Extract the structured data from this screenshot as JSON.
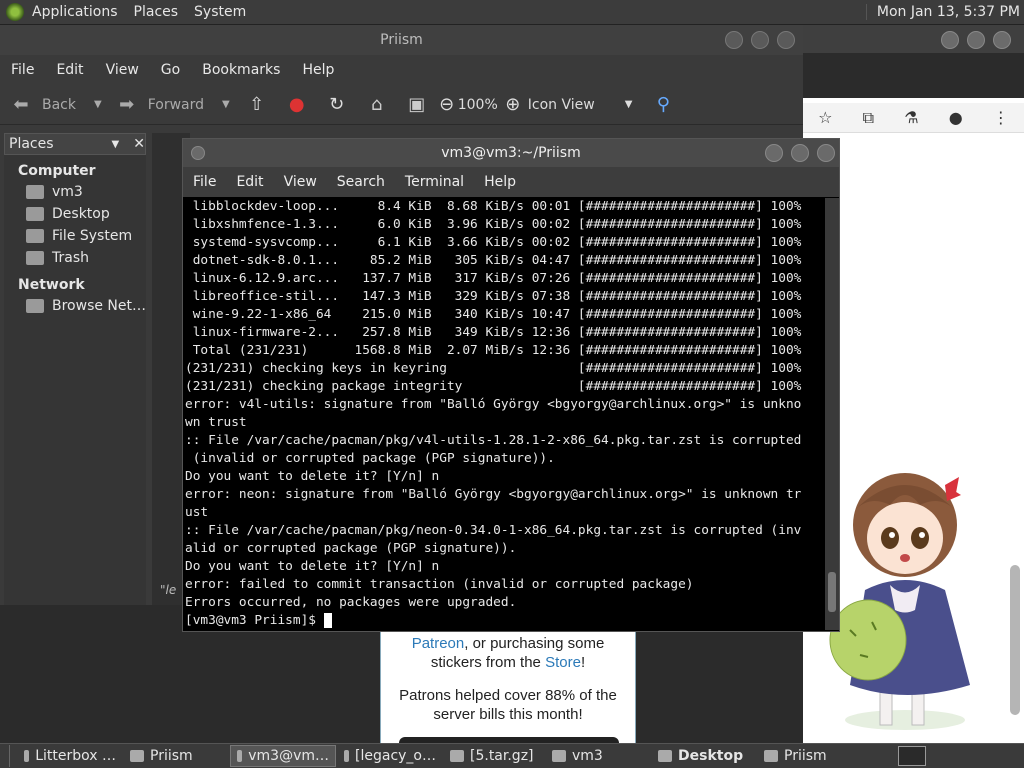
{
  "top_panel": {
    "menus": [
      "Applications",
      "Places",
      "System"
    ],
    "clock": "Mon Jan 13,  5:37 PM"
  },
  "file_manager": {
    "title": "Priism",
    "menu": [
      "File",
      "Edit",
      "View",
      "Go",
      "Bookmarks",
      "Help"
    ],
    "toolbar": {
      "back": "Back",
      "forward": "Forward",
      "zoom": "100%",
      "view_mode": "Icon View"
    },
    "sidebar": {
      "header": "Places",
      "sections": [
        {
          "title": "Computer",
          "items": [
            "vm3",
            "Desktop",
            "File System",
            "Trash"
          ]
        },
        {
          "title": "Network",
          "items": [
            "Browse Net…"
          ]
        }
      ]
    },
    "status_fragment": "\"le"
  },
  "terminal": {
    "title": "vm3@vm3:~/Priism",
    "menu": [
      "File",
      "Edit",
      "View",
      "Search",
      "Terminal",
      "Help"
    ],
    "lines": [
      " libblockdev-loop...     8.4 KiB  8.68 KiB/s 00:01 [######################] 100%",
      " libxshmfence-1.3...     6.0 KiB  3.96 KiB/s 00:02 [######################] 100%",
      " systemd-sysvcomp...     6.1 KiB  3.66 KiB/s 00:02 [######################] 100%",
      " dotnet-sdk-8.0.1...    85.2 MiB   305 KiB/s 04:47 [######################] 100%",
      " linux-6.12.9.arc...   137.7 MiB   317 KiB/s 07:26 [######################] 100%",
      " libreoffice-stil...   147.3 MiB   329 KiB/s 07:38 [######################] 100%",
      " wine-9.22-1-x86_64    215.0 MiB   340 KiB/s 10:47 [######################] 100%",
      " linux-firmware-2...   257.8 MiB   349 KiB/s 12:36 [######################] 100%",
      " Total (231/231)      1568.8 MiB  2.07 MiB/s 12:36 [######################] 100%",
      "(231/231) checking keys in keyring                 [######################] 100%",
      "(231/231) checking package integrity               [######################] 100%",
      "error: v4l-utils: signature from \"Balló György <bgyorgy@archlinux.org>\" is unkno",
      "wn trust",
      ":: File /var/cache/pacman/pkg/v4l-utils-1.28.1-2-x86_64.pkg.tar.zst is corrupted",
      " (invalid or corrupted package (PGP signature)).",
      "Do you want to delete it? [Y/n] n",
      "error: neon: signature from \"Balló György <bgyorgy@archlinux.org>\" is unknown tr",
      "ust",
      ":: File /var/cache/pacman/pkg/neon-0.34.0-1-x86_64.pkg.tar.zst is corrupted (inv",
      "alid or corrupted package (PGP signature)).",
      "Do you want to delete it? [Y/n] n",
      "error: failed to commit transaction (invalid or corrupted package)",
      "Errors occurred, no packages were upgraded."
    ],
    "prompt": "[vm3@vm3 Priism]$ "
  },
  "web_page": {
    "line1_link": "Patreon",
    "line1_rest": ", or purchasing some",
    "line2_pre": "stickers from the ",
    "line2_link": "Store",
    "line2_post": "!",
    "patrons": "Patrons helped cover 88% of the server bills this month!"
  },
  "taskbar": {
    "tasks": [
      {
        "label": "Litterbox …",
        "active": false,
        "bold": false
      },
      {
        "label": "Priism",
        "active": false,
        "bold": false
      },
      {
        "label": "vm3@vm…",
        "active": true,
        "bold": false
      },
      {
        "label": "[legacy_o…",
        "active": false,
        "bold": false
      },
      {
        "label": "[5.tar.gz]",
        "active": false,
        "bold": false
      },
      {
        "label": "vm3",
        "active": false,
        "bold": false
      },
      {
        "label": "Desktop",
        "active": false,
        "bold": true
      },
      {
        "label": "Priism",
        "active": false,
        "bold": false
      }
    ]
  }
}
